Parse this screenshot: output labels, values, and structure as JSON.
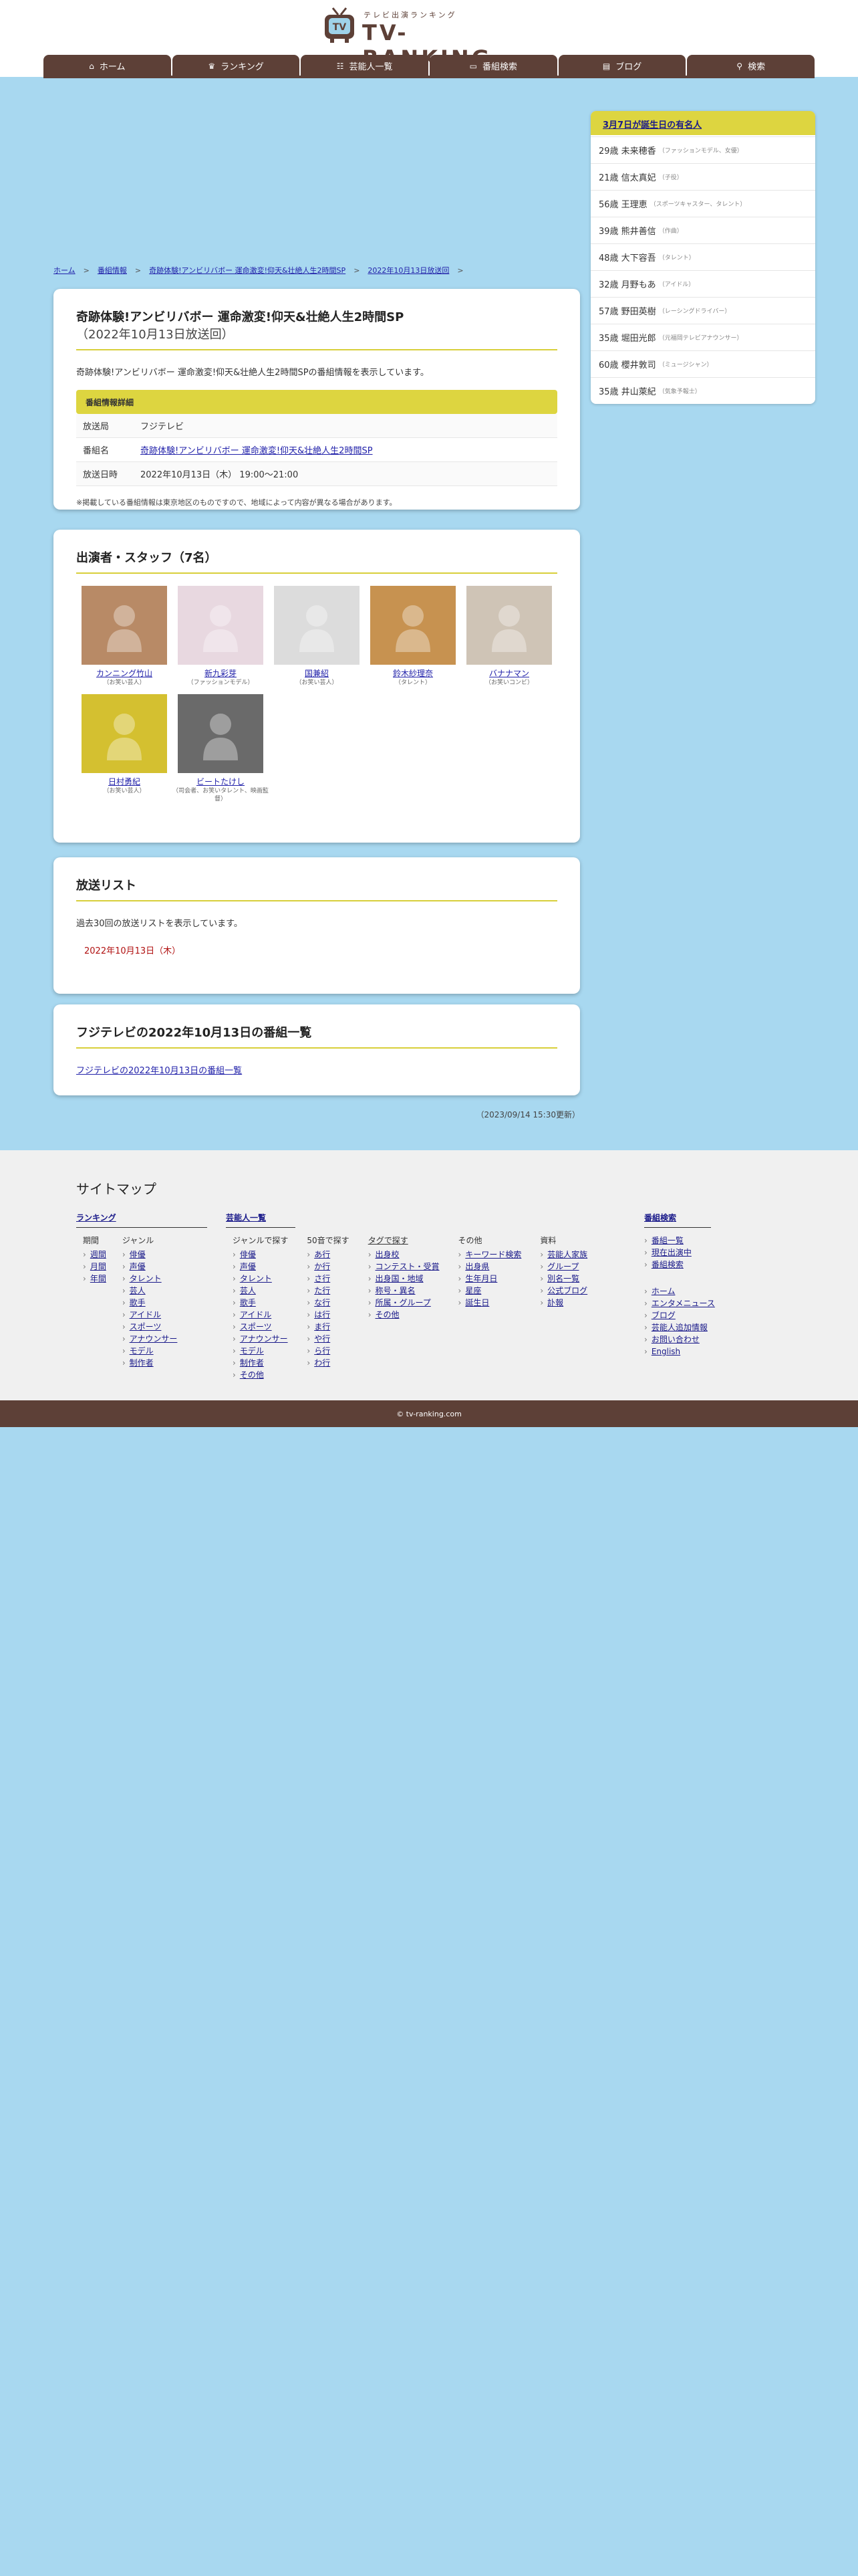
{
  "header": {
    "logo_sub": "テレビ出演ランキング",
    "logo_main": "TV-RANKING",
    "nav": [
      {
        "icon": "⌂",
        "label": "ホーム"
      },
      {
        "icon": "♛",
        "label": "ランキング"
      },
      {
        "icon": "☷",
        "label": "芸能人一覧"
      },
      {
        "icon": "▭",
        "label": "番組検索"
      },
      {
        "icon": "▤",
        "label": "ブログ"
      },
      {
        "icon": "⚲",
        "label": "検索"
      }
    ]
  },
  "sidebar": {
    "title": "3月7日が誕生日の有名人",
    "items": [
      {
        "label": "29歳 未来穂香",
        "note": "（ファッションモデル、女優）"
      },
      {
        "label": "21歳 信太真妃",
        "note": "（子役）"
      },
      {
        "label": "56歳 王理恵",
        "note": "（スポーツキャスター、タレント）"
      },
      {
        "label": "39歳 熊井善信",
        "note": "（作曲）"
      },
      {
        "label": "48歳 大下容吾",
        "note": "（タレント）"
      },
      {
        "label": "32歳 月野もあ",
        "note": "（アイドル）"
      },
      {
        "label": "57歳 野田英樹",
        "note": "（レーシングドライバー）"
      },
      {
        "label": "35歳 堀田光郎",
        "note": "（元福岡テレビアナウンサー）"
      },
      {
        "label": "60歳 櫻井敦司",
        "note": "（ミュージシャン）"
      },
      {
        "label": "35歳 井山萊紀",
        "note": "（気象予報士）"
      }
    ]
  },
  "breadcrumb": {
    "home": "ホーム",
    "info": "番組情報",
    "program": "奇跡体験!アンビリバボー 運命激変!仰天&壮絶人生2時間SP",
    "broadcast": "2022年10月13日放送回",
    "sep": ">"
  },
  "program": {
    "title": "奇跡体験!アンビリバボー 運命激変!仰天&壮絶人生2時間SP",
    "date": "（2022年10月13日放送回）",
    "desc": "奇跡体験!アンビリバボー 運命激変!仰天&壮絶人生2時間SPの番組情報を表示しています。",
    "detail_head": "番組情報詳細",
    "rows": {
      "station_k": "放送局",
      "station_v": "フジテレビ",
      "name_k": "番組名",
      "name_v": "奇跡体験!アンビリバボー 運命激変!仰天&壮絶人生2時間SP",
      "date_k": "放送日時",
      "date_v": "2022年10月13日（木） 19:00〜21:00"
    },
    "note": "※掲載している番組情報は東京地区のものですので、地域によって内容が異なる場合があります。"
  },
  "cast": {
    "title": "出演者・スタッフ（7名）",
    "people": [
      {
        "name": "カンニング竹山",
        "role": "（お笑い芸人）",
        "bg": "#b88a66"
      },
      {
        "name": "新九彩芽",
        "role": "（ファッションモデル）",
        "bg": "#e8d8e0"
      },
      {
        "name": "国兼紹",
        "role": "（お笑い芸人）",
        "bg": "#dcdcdc"
      },
      {
        "name": "鈴木紗理奈",
        "role": "（タレント）",
        "bg": "#c79250"
      },
      {
        "name": "バナナマン",
        "role": "（お笑いコンビ）",
        "bg": "#cfc4b6"
      },
      {
        "name": "日村勇紀",
        "role": "（お笑い芸人）",
        "bg": "#d4c030"
      },
      {
        "name": "ビートたけし",
        "role": "（司会者、お笑いタレント、映画監督）",
        "bg": "#6a6a6a"
      }
    ]
  },
  "broadcast": {
    "title": "放送リスト",
    "sub": "過去30回の放送リストを表示しています。",
    "item": "2022年10月13日（木）"
  },
  "daylist": {
    "title": "フジテレビの2022年10月13日の番組一覧",
    "link": "フジテレビの2022年10月13日の番組一覧"
  },
  "updated": "（2023/09/14 15:30更新）",
  "sitemap": {
    "title": "サイトマップ",
    "ranking": {
      "head": "ランキング",
      "period_h": "期間",
      "periods": [
        "週間",
        "月間",
        "年間"
      ],
      "genre_h": "ジャンル",
      "genres": [
        "俳優",
        "声優",
        "タレント",
        "芸人",
        "歌手",
        "アイドル",
        "スポーツ",
        "アナウンサー",
        "モデル",
        "制作者"
      ]
    },
    "people": {
      "head": "芸能人一覧",
      "genre_h": "ジャンルで探す",
      "genres": [
        "俳優",
        "声優",
        "タレント",
        "芸人",
        "歌手",
        "アイドル",
        "スポーツ",
        "アナウンサー",
        "モデル",
        "制作者",
        "その他"
      ],
      "kana_h": "50音で探す",
      "kana": [
        "あ行",
        "か行",
        "さ行",
        "た行",
        "な行",
        "は行",
        "ま行",
        "や行",
        "ら行",
        "わ行"
      ],
      "tag_h": "タグで探す",
      "tags": [
        "出身校",
        "コンテスト・受賞",
        "出身国・地域",
        "称号・異名",
        "所属・グループ",
        "その他"
      ],
      "other_h": "その他",
      "others": [
        "キーワード検索",
        "出身県",
        "生年月日",
        "星座",
        "誕生日"
      ],
      "misc_h": "資料",
      "misc": [
        "芸能人家族",
        "グループ",
        "別名一覧",
        "公式ブログ",
        "訃報"
      ]
    },
    "program": {
      "head": "番組検索",
      "items": [
        "番組一覧",
        "現在出演中",
        "番組検索"
      ],
      "links": [
        "ホーム",
        "エンタメニュース",
        "ブログ",
        "芸能人追加情報",
        "お問い合わせ",
        "English"
      ]
    }
  },
  "footer": "© tv-ranking.com"
}
